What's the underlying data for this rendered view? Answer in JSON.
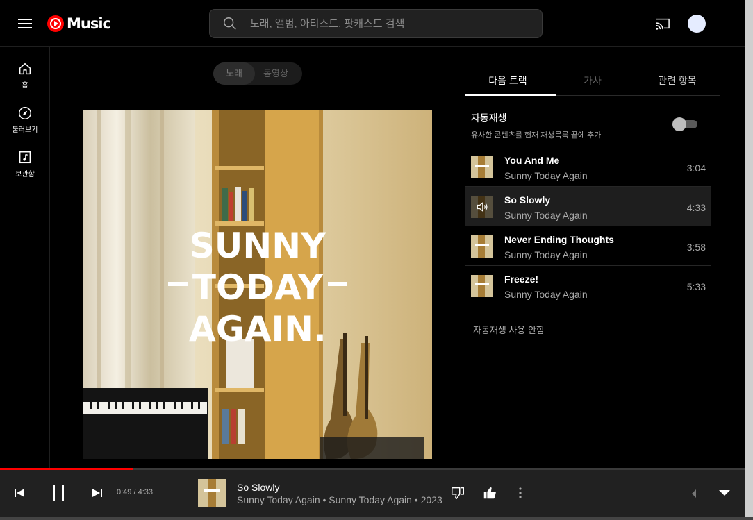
{
  "header": {
    "logo_text": "Music",
    "search_placeholder": "노래, 앨범, 아티스트, 팟캐스트 검색"
  },
  "sidebar": {
    "items": [
      {
        "label": "홈",
        "icon": "home-icon"
      },
      {
        "label": "둘러보기",
        "icon": "explore-icon"
      },
      {
        "label": "보관함",
        "icon": "library-icon"
      }
    ]
  },
  "view_toggle": {
    "song": "노래",
    "video": "동영상"
  },
  "album_art": {
    "line1": "SUNNY",
    "line2": "TODAY",
    "line3": "AGAIN."
  },
  "tabs": [
    {
      "label": "다음 트랙"
    },
    {
      "label": "가사"
    },
    {
      "label": "관련 항목"
    }
  ],
  "autoplay": {
    "title": "자동재생",
    "subtitle": "유사한 콘텐츠를 현재 재생목록 끝에 추가",
    "enabled": false,
    "off_label": "자동재생 사용 안함"
  },
  "queue": [
    {
      "title": "You And Me",
      "artist": "Sunny Today Again",
      "duration": "3:04",
      "playing": false
    },
    {
      "title": "So Slowly",
      "artist": "Sunny Today Again",
      "duration": "4:33",
      "playing": true
    },
    {
      "title": "Never Ending Thoughts",
      "artist": "Sunny Today Again",
      "duration": "3:58",
      "playing": false
    },
    {
      "title": "Freeze!",
      "artist": "Sunny Today Again",
      "duration": "5:33",
      "playing": false
    }
  ],
  "player": {
    "time": "0:49 / 4:33",
    "progress_fraction": 0.179,
    "title": "So Slowly",
    "subtitle": "Sunny Today Again • Sunny Today Again • 2023"
  },
  "colors": {
    "accent": "#ff0000",
    "background": "#000000",
    "player_bg": "#212121",
    "text_secondary": "#aaaaaa"
  }
}
